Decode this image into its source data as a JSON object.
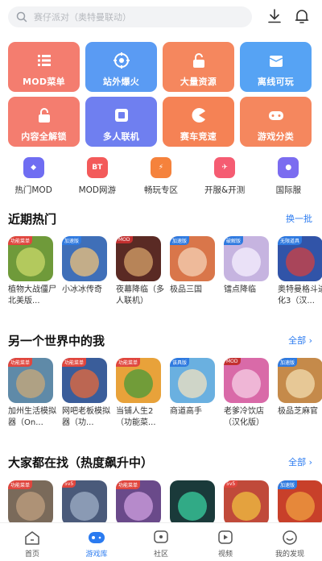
{
  "search": {
    "placeholder": "赛仔派对（奥特曼联动）"
  },
  "features": [
    {
      "label": "MOD菜单",
      "color": "#f47d6f"
    },
    {
      "label": "站外爆火",
      "color": "#5a9bf3"
    },
    {
      "label": "大量资源",
      "color": "#f5875e"
    },
    {
      "label": "离线可玩",
      "color": "#56a3f4"
    },
    {
      "label": "内容全解锁",
      "color": "#f47d6f"
    },
    {
      "label": "多人联机",
      "color": "#6f7ff0"
    },
    {
      "label": "赛车竞速",
      "color": "#f58255"
    },
    {
      "label": "游戏分类",
      "color": "#f5875e"
    }
  ],
  "categories": [
    {
      "label": "热门MOD",
      "color": "#6f6df2",
      "glyph": "◆"
    },
    {
      "label": "MOD网游",
      "color": "#f35a5a",
      "glyph": "BT"
    },
    {
      "label": "畅玩专区",
      "color": "#f5823c",
      "glyph": "⚡"
    },
    {
      "label": "开服&开测",
      "color": "#f55c72",
      "glyph": "✈"
    },
    {
      "label": "国际服",
      "color": "#7b6cf0",
      "glyph": "●"
    }
  ],
  "sections": {
    "recent": {
      "title": "近期热门",
      "more": "换一批",
      "games": [
        {
          "name": "植物大战僵尸北美版...",
          "badge": "功能菜单",
          "badge_color": "#e0463e",
          "bg": "#6f9a3a",
          "accent": "#c9d86a"
        },
        {
          "name": "小冰冰传奇",
          "badge": "加速版",
          "badge_color": "#2f7ae0",
          "bg": "#3f6fb8",
          "accent": "#f0c27a"
        },
        {
          "name": "夜幕降临（多人联机）",
          "badge": "MOD",
          "badge_color": "#c32f2f",
          "bg": "#5a2a24",
          "accent": "#d7a36a"
        },
        {
          "name": "极品三国",
          "badge": "加速版",
          "badge_color": "#2f7ae0",
          "bg": "#d9764a",
          "accent": "#f4d1b6"
        },
        {
          "name": "镭点降临",
          "badge": "破解版",
          "badge_color": "#2f7ae0",
          "bg": "#c6b4e0",
          "accent": "#f5f0ff"
        },
        {
          "name": "奥特曼格斗进化3（汉...",
          "badge": "无限道具",
          "badge_color": "#2f7ae0",
          "bg": "#3154a8",
          "accent": "#d24040"
        }
      ]
    },
    "world": {
      "title": "另一个世界中的我",
      "more": "全部",
      "games": [
        {
          "name": "加州生活模拟器（On...",
          "badge": "功能菜单",
          "badge_color": "#e0463e",
          "bg": "#5f8aa8",
          "accent": "#c9a878"
        },
        {
          "name": "网吧老板模拟器（功...",
          "badge": "功能菜单",
          "badge_color": "#e0463e",
          "bg": "#3a5d9a",
          "accent": "#e86a3a"
        },
        {
          "name": "当铺人生2（功能菜...",
          "badge": "功能菜单",
          "badge_color": "#e0463e",
          "bg": "#e8a23a",
          "accent": "#4a9a3a"
        },
        {
          "name": "商道高手",
          "badge": "该具版",
          "badge_color": "#2f7ae0",
          "bg": "#6ab0e0",
          "accent": "#f2e2c0"
        },
        {
          "name": "老爹冷饮店（汉化版）",
          "badge": "MOD",
          "badge_color": "#c32f2f",
          "bg": "#d96aa8",
          "accent": "#f6d0e6"
        },
        {
          "name": "极品芝麻官",
          "badge": "加速版",
          "badge_color": "#2f7ae0",
          "bg": "#c58a4a",
          "accent": "#f2dcb0"
        }
      ]
    },
    "trending": {
      "title": "大家都在找（热度飙升中）",
      "more": "全部",
      "games": [
        {
          "badge": "功能菜单",
          "badge_color": "#e0463e",
          "bg": "#7a6a5a",
          "accent": "#c0a080"
        },
        {
          "badge": "5v5",
          "badge_color": "#e0463e",
          "bg": "#4a5a7a",
          "accent": "#a0b0c8"
        },
        {
          "badge": "功能菜单",
          "badge_color": "#e0463e",
          "bg": "#6a4a8a",
          "accent": "#d0a0e0"
        },
        {
          "badge": "",
          "badge_color": "#2f7ae0",
          "bg": "#1a3a3a",
          "accent": "#3ad0a0"
        },
        {
          "badge": "5v5",
          "badge_color": "#e0463e",
          "bg": "#c04a3a",
          "accent": "#f0c040"
        },
        {
          "badge": "加速版",
          "badge_color": "#2f7ae0",
          "bg": "#c8402a",
          "accent": "#f0a040"
        }
      ]
    }
  },
  "tabs": [
    {
      "label": "首页",
      "active": false
    },
    {
      "label": "游戏库",
      "active": true
    },
    {
      "label": "社区",
      "active": false
    },
    {
      "label": "视频",
      "active": false
    },
    {
      "label": "我的发现",
      "active": false
    }
  ],
  "colors": {
    "accent": "#2b7bf0"
  }
}
